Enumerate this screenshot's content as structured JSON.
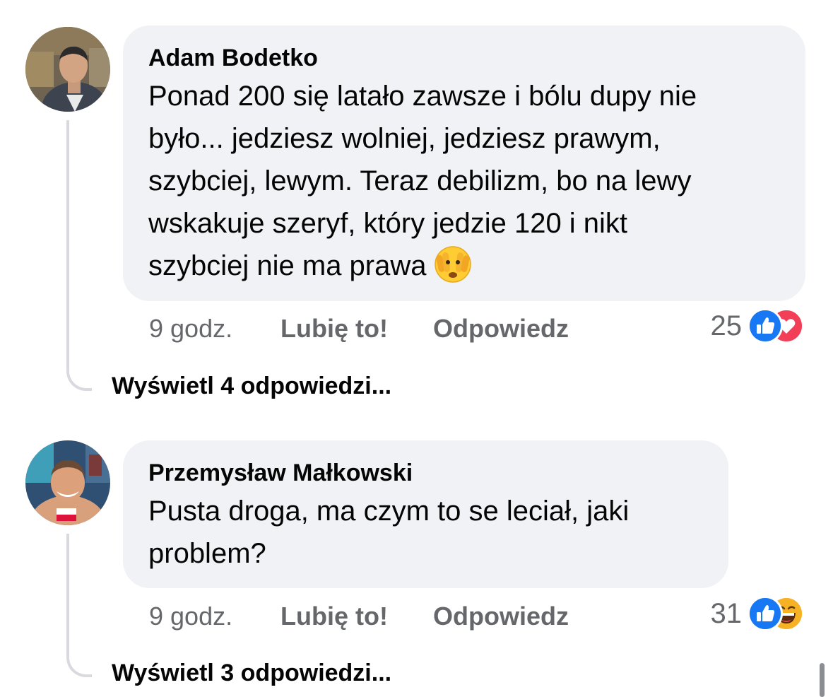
{
  "comments": [
    {
      "author": "Adam Bodetko",
      "text_lines": [
        "Ponad 200 się latało zawsze i bólu dupy nie",
        "było... jedziesz wolniej, jedziesz prawym,",
        "szybciej, lewym. Teraz debilizm, bo na lewy",
        "wskakuje szeryf, który jedzie 120 i nikt",
        "szybciej nie ma prawa"
      ],
      "emoji": "face-with-hands-over-eyes-emoji",
      "time": "9 godz.",
      "like_label": "Lubię to!",
      "reply_label": "Odpowiedz",
      "reaction_count": "25",
      "reactions": [
        "like-icon",
        "love-icon"
      ],
      "view_replies": "Wyświetl 4 odpowiedzi..."
    },
    {
      "author": "Przemysław Małkowski",
      "text_lines": [
        "Pusta droga, ma czym to se leciał, jaki",
        "problem?"
      ],
      "time": "9 godz.",
      "like_label": "Lubię to!",
      "reply_label": "Odpowiedz",
      "reaction_count": "31",
      "reactions": [
        "like-icon",
        "haha-icon"
      ],
      "view_replies": "Wyświetl 3 odpowiedzi..."
    }
  ],
  "colors": {
    "bubble": "#f0f2f5",
    "meta_text": "#65676b",
    "like_blue": "#1877f2",
    "love_red": "#f33e58",
    "thread_line": "#d8dadf"
  }
}
